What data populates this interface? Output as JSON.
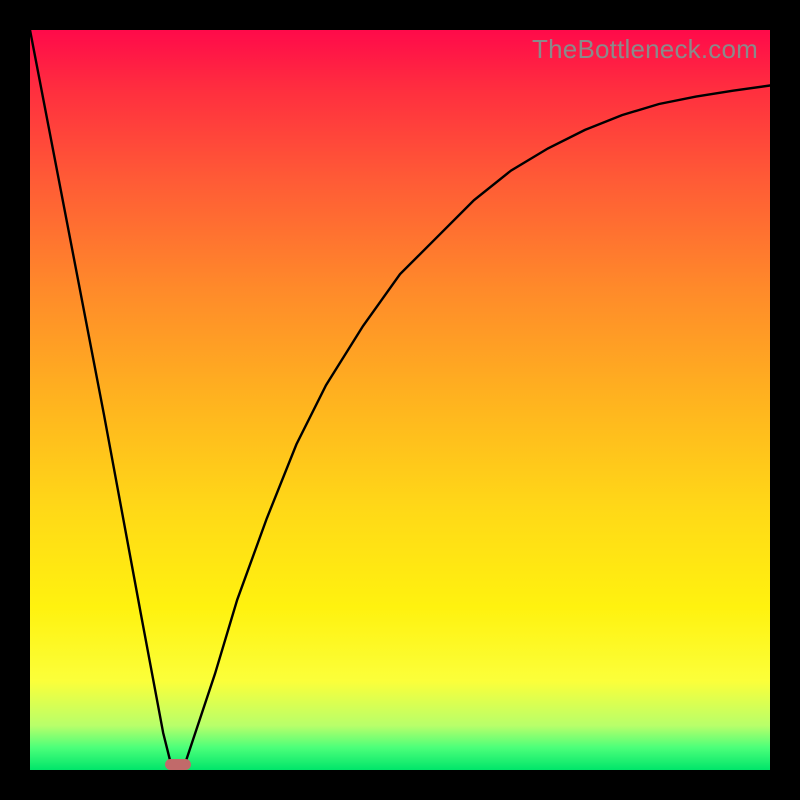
{
  "watermark": "TheBottleneck.com",
  "chart_data": {
    "type": "line",
    "title": "",
    "xlabel": "",
    "ylabel": "",
    "xlim": [
      0,
      100
    ],
    "ylim": [
      0,
      100
    ],
    "series": [
      {
        "name": "bottleneck-curve",
        "x": [
          0,
          5,
          10,
          15,
          18,
          19,
          20,
          21,
          22,
          25,
          28,
          32,
          36,
          40,
          45,
          50,
          55,
          60,
          65,
          70,
          75,
          80,
          85,
          90,
          95,
          100
        ],
        "y": [
          100,
          74,
          48,
          21,
          5,
          1,
          0,
          1,
          4,
          13,
          23,
          34,
          44,
          52,
          60,
          67,
          72,
          77,
          81,
          84,
          86.5,
          88.5,
          90,
          91,
          91.8,
          92.5
        ]
      }
    ],
    "marker": {
      "x_start": 18.2,
      "x_end": 21.8,
      "y": 0
    },
    "grid": false,
    "legend": false
  },
  "colors": {
    "curve": "#000000",
    "marker": "#c16a6a",
    "frame": "#000000"
  }
}
